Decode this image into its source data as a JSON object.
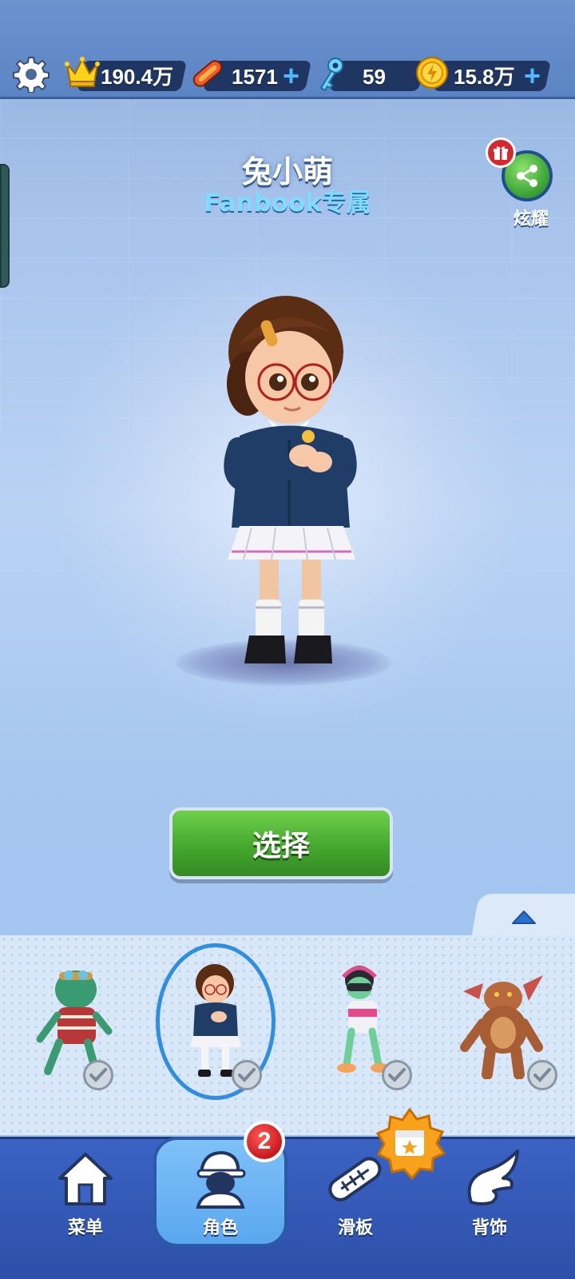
{
  "currency": {
    "score": "190.4万",
    "hoverboards": "1571",
    "keys": "59",
    "coins": "15.8万"
  },
  "character": {
    "name": "兔小萌",
    "subtitle": "Fanbook专属"
  },
  "share": {
    "label": "炫耀"
  },
  "select_button": {
    "label": "选择"
  },
  "carousel": {
    "characters": [
      "goblin-character",
      "tu-xiao-meng-character",
      "headphone-character",
      "dragon-character"
    ],
    "selected_index": 1
  },
  "nav": {
    "items": [
      {
        "label": "菜单",
        "icon": "home-icon"
      },
      {
        "label": "角色",
        "icon": "character-icon"
      },
      {
        "label": "滑板",
        "icon": "skateboard-icon"
      },
      {
        "label": "背饰",
        "icon": "wings-icon"
      }
    ],
    "active_index": 1,
    "character_badge": "2"
  },
  "colors": {
    "select_green": "#45a82e",
    "nav_blue": "#3b63c4",
    "badge_red": "#c8191e"
  }
}
